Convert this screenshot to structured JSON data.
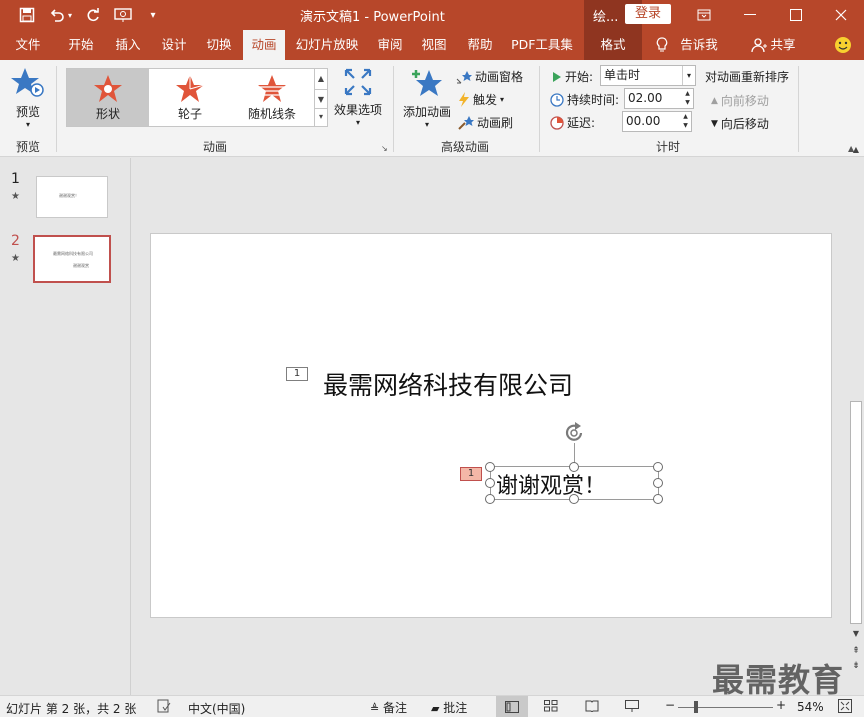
{
  "window": {
    "title": "演示文稿1  -  PowerPoint",
    "context_label": "绘...",
    "login_label": "登录"
  },
  "tabs": [
    "文件",
    "开始",
    "插入",
    "设计",
    "切换",
    "动画",
    "幻灯片放映",
    "审阅",
    "视图",
    "帮助",
    "PDF工具集",
    "格式"
  ],
  "tabs_right": {
    "tell_me": "告诉我",
    "share": "共享"
  },
  "ribbon": {
    "preview": {
      "label": "预览",
      "group": "预览"
    },
    "animation": {
      "group": "动画",
      "items": [
        {
          "label": "形状",
          "selected": true
        },
        {
          "label": "轮子",
          "selected": false
        },
        {
          "label": "随机线条",
          "selected": false
        }
      ],
      "effect_options": "效果选项"
    },
    "advanced": {
      "group": "高级动画",
      "add_animation": "添加动画",
      "animation_pane": "动画窗格",
      "trigger": "触发",
      "animation_painter": "动画刷"
    },
    "timing": {
      "group": "计时",
      "start_label": "开始:",
      "start_value": "单击时",
      "duration_label": "持续时间:",
      "duration_value": "02.00",
      "delay_label": "延迟:",
      "delay_value": "00.00",
      "reorder_title": "对动画重新排序",
      "move_earlier": "向前移动",
      "move_later": "向后移动"
    }
  },
  "slides": [
    {
      "number": "1",
      "thumb_text": "谢谢观赏！"
    },
    {
      "number": "2",
      "thumb_text": "最需网络科技有限公司",
      "thumb_sub": "谢谢观赏"
    }
  ],
  "slide": {
    "title_text": "最需网络科技有限公司",
    "title_anim_tag": "1",
    "thanks_text": "谢谢观赏！",
    "thanks_anim_tag": "1"
  },
  "status": {
    "slide_info": "幻灯片 第 2 张，共 2 张",
    "language": "中文(中国)",
    "notes": "备注",
    "comments": "批注",
    "zoom": "54%"
  },
  "watermark": "最需教育",
  "colors": {
    "accent": "#b7472a",
    "accent_dark": "#8f3520",
    "star_orange": "#e0553a",
    "star_blue": "#3a78c3"
  }
}
